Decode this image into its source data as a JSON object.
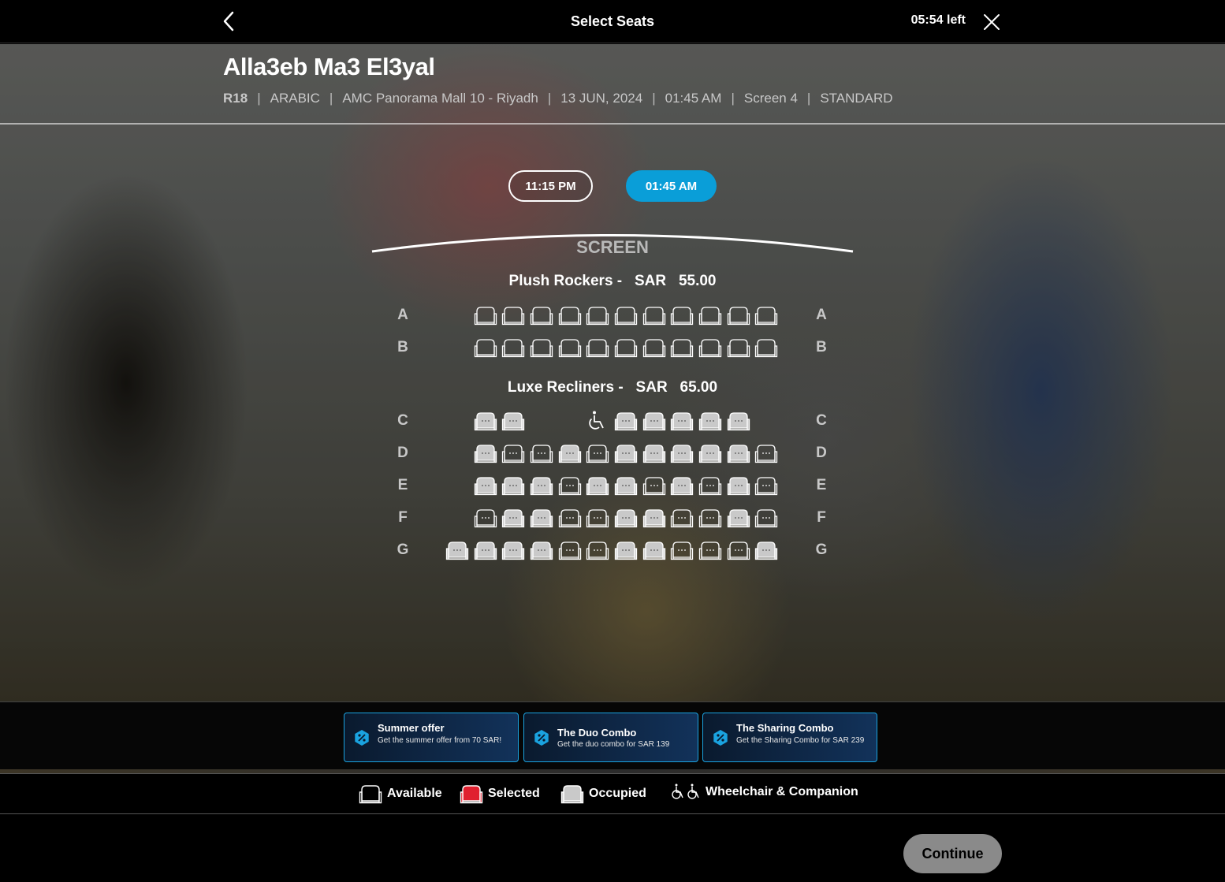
{
  "header": {
    "title": "Select Seats",
    "timer": "05:54 left"
  },
  "movie": {
    "title": "Alla3eb Ma3 El3yal",
    "rating": "R18",
    "language": "ARABIC",
    "cinema": "AMC Panorama Mall 10 - Riyadh",
    "date": "13 JUN, 2024",
    "time": "01:45 AM",
    "screen": "Screen 4",
    "experience": "STANDARD"
  },
  "showtimes": [
    {
      "label": "11:15 PM",
      "selected": false
    },
    {
      "label": "01:45 AM",
      "selected": true
    }
  ],
  "screen_label": "SCREEN",
  "sections": [
    {
      "name": "Plush Rockers -",
      "currency": "SAR",
      "price": "55.00"
    },
    {
      "name": "Luxe Recliners -",
      "currency": "SAR",
      "price": "65.00"
    }
  ],
  "rows": [
    "A",
    "B",
    "C",
    "D",
    "E",
    "F",
    "G"
  ],
  "seat_status": {
    "A": [
      "available",
      "available",
      "available",
      "available",
      "available",
      "available",
      "available",
      "available",
      "available",
      "available",
      "available"
    ],
    "B": [
      "available",
      "available",
      "available",
      "available",
      "available",
      "available",
      "available",
      "available",
      "available",
      "available",
      "available"
    ],
    "C": [
      "occupied",
      "occupied",
      "wheelchair",
      "occupied",
      "occupied",
      "occupied",
      "occupied",
      "occupied"
    ],
    "D": [
      "occupied",
      "available",
      "available",
      "occupied",
      "available",
      "occupied",
      "occupied",
      "occupied",
      "occupied",
      "occupied",
      "available"
    ],
    "E": [
      "occupied",
      "occupied",
      "occupied",
      "available",
      "occupied",
      "occupied",
      "available",
      "occupied",
      "available",
      "occupied",
      "available"
    ],
    "F": [
      "available",
      "occupied",
      "occupied",
      "available",
      "available",
      "occupied",
      "occupied",
      "available",
      "available",
      "occupied",
      "available"
    ],
    "G": [
      "occupied",
      "occupied",
      "occupied",
      "occupied",
      "available",
      "available",
      "occupied",
      "occupied",
      "available",
      "available",
      "available",
      "occupied"
    ]
  },
  "offers": [
    {
      "title": "Summer offer",
      "desc": "Get the summer offer from 70 SAR!"
    },
    {
      "title": "The Duo Combo",
      "desc": "Get the duo combo for SAR 139"
    },
    {
      "title": "The Sharing Combo",
      "desc": "Get the Sharing Combo for SAR 239"
    }
  ],
  "legend": {
    "available": "Available",
    "selected": "Selected",
    "occupied": "Occupied",
    "wheelchair": "Wheelchair & Companion"
  },
  "continue_label": "Continue",
  "colors": {
    "accent": "#0a9ed8",
    "selected": "#e0202f",
    "occupied": "#c9c9c9",
    "continue_disabled": "#8a8a8a"
  }
}
